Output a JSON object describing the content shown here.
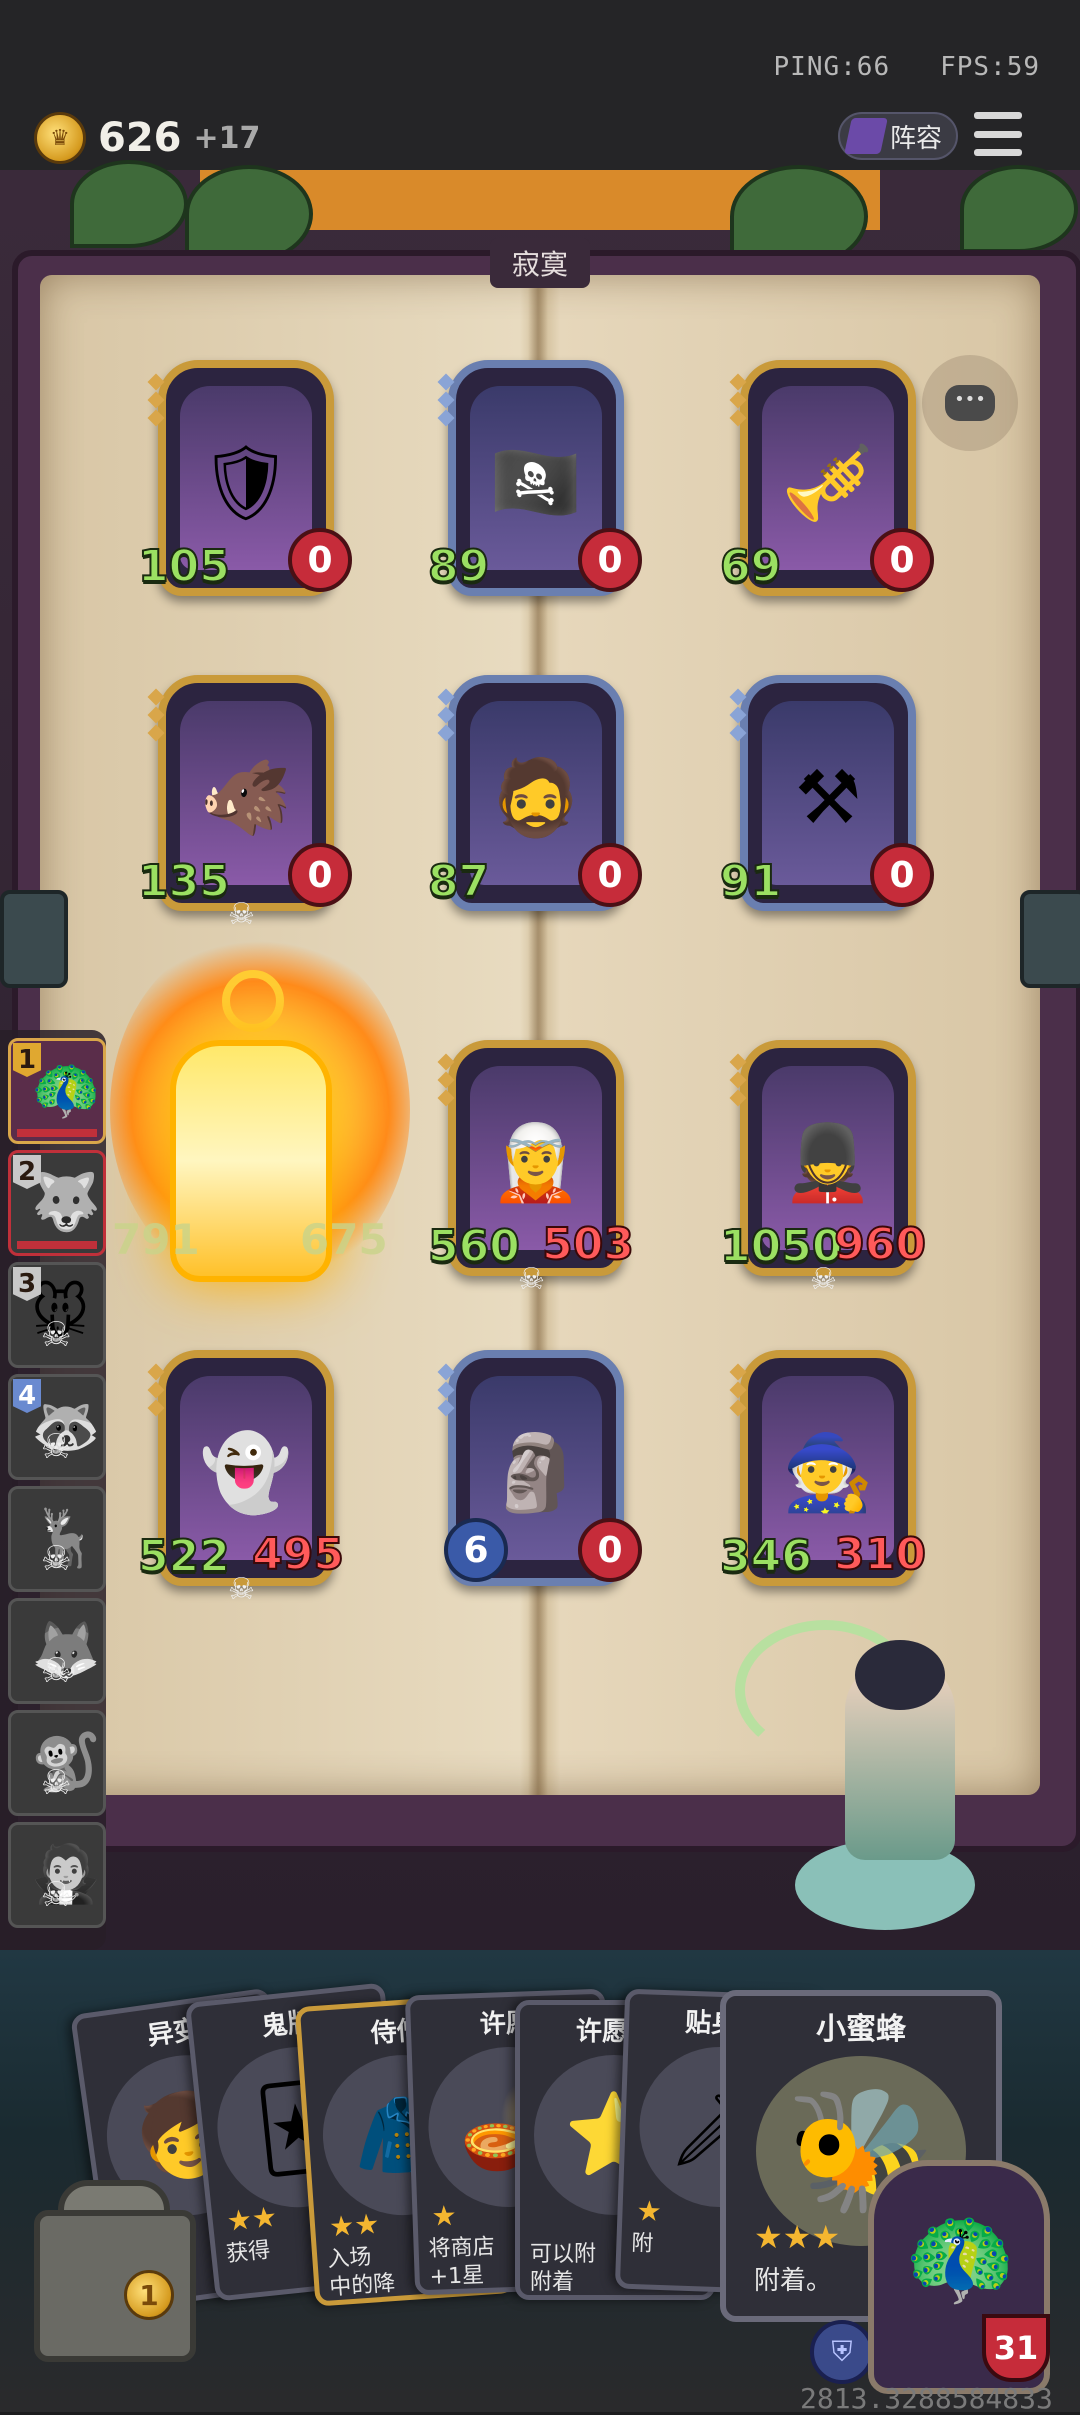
{
  "status": {
    "ping": "PING:66",
    "fps": "FPS:59"
  },
  "gold": {
    "value": "626",
    "increment": "+17"
  },
  "header": {
    "lineup_label": "阵容",
    "book_title": "寂寞"
  },
  "board": {
    "units": [
      {
        "atk": "105",
        "hp": "0",
        "frame": "gold",
        "icon": "armored-knight",
        "glyph": "🛡",
        "skull": false
      },
      {
        "atk": "89",
        "hp": "0",
        "frame": "blue",
        "icon": "pirate-woman",
        "glyph": "🏴‍☠️",
        "skull": false
      },
      {
        "atk": "69",
        "hp": "0",
        "frame": "gold",
        "icon": "trumpeter",
        "glyph": "🎺",
        "skull": false
      },
      {
        "atk": "135",
        "hp": "0",
        "frame": "gold",
        "icon": "fire-beast",
        "glyph": "🐗",
        "skull": true
      },
      {
        "atk": "87",
        "hp": "0",
        "frame": "blue",
        "icon": "bearded-brute",
        "glyph": "🧔",
        "skull": false
      },
      {
        "atk": "91",
        "hp": "0",
        "frame": "blue",
        "icon": "blacksmith-girl",
        "glyph": "⚒",
        "skull": false
      },
      {
        "atk": "560",
        "hp": "503",
        "frame": "gold",
        "icon": "elf-sorceress",
        "glyph": "🧝",
        "skull": true
      },
      {
        "atk": "1050",
        "hp": "960",
        "frame": "gold",
        "icon": "toy-soldier",
        "glyph": "💂",
        "skull": true
      },
      {
        "atk": "522",
        "hp": "495",
        "frame": "gold",
        "icon": "ghost-ogre",
        "glyph": "👻",
        "skull": true
      },
      {
        "atk": "6",
        "hp": "0",
        "frame": "blue",
        "icon": "ice-statue",
        "glyph": "🗿",
        "skull": false
      },
      {
        "atk": "346",
        "hp": "310",
        "frame": "gold",
        "icon": "star-wizard",
        "glyph": "🧙",
        "skull": false
      }
    ],
    "lantern": {
      "left": "791",
      "right": "675"
    }
  },
  "sidebar": [
    {
      "num": "1",
      "face": "🦚",
      "state": "active"
    },
    {
      "num": "2",
      "face": "🐺",
      "state": "sel"
    },
    {
      "num": "3",
      "face": "🐭",
      "state": "dead"
    },
    {
      "num": "4",
      "face": "🦝",
      "state": "dead"
    },
    {
      "num": "",
      "face": "🦌",
      "state": "dead"
    },
    {
      "num": "",
      "face": "🦊",
      "state": "dead"
    },
    {
      "num": "",
      "face": "🐒",
      "state": "dead"
    },
    {
      "num": "",
      "face": "🧛",
      "state": "dead"
    }
  ],
  "hand": [
    {
      "name": "异变",
      "glyph": "🧒",
      "stars": "",
      "desc": ""
    },
    {
      "name": "鬼牌",
      "glyph": "🃏",
      "stars": "★★",
      "desc": "获得"
    },
    {
      "name": "侍僧",
      "glyph": "🧥",
      "stars": "★★",
      "desc": "入场\n中的降"
    },
    {
      "name": "许愿",
      "glyph": "🪔",
      "stars": "★",
      "desc": "将商店\n+1星"
    },
    {
      "name": "许愿星",
      "glyph": "⭐",
      "stars": "",
      "desc": "可以附\n附着"
    },
    {
      "name": "贴身侍",
      "glyph": "🗡",
      "stars": "★",
      "desc": "附"
    }
  ],
  "featured_card": {
    "name": "小蜜蜂",
    "glyph": "🐝",
    "stars": "★★★",
    "desc": "附着。"
  },
  "shop": {
    "coins": "1"
  },
  "hero": {
    "hp": "31",
    "glyph": "🦚"
  },
  "footer": {
    "coords": "2813.3288584833"
  },
  "colors": {
    "atk": "#9be062",
    "hp": "#c62c3a",
    "gold_frame": "#c99a3a",
    "blue_frame": "#6a7fb0",
    "page": "#e6d7bb"
  }
}
